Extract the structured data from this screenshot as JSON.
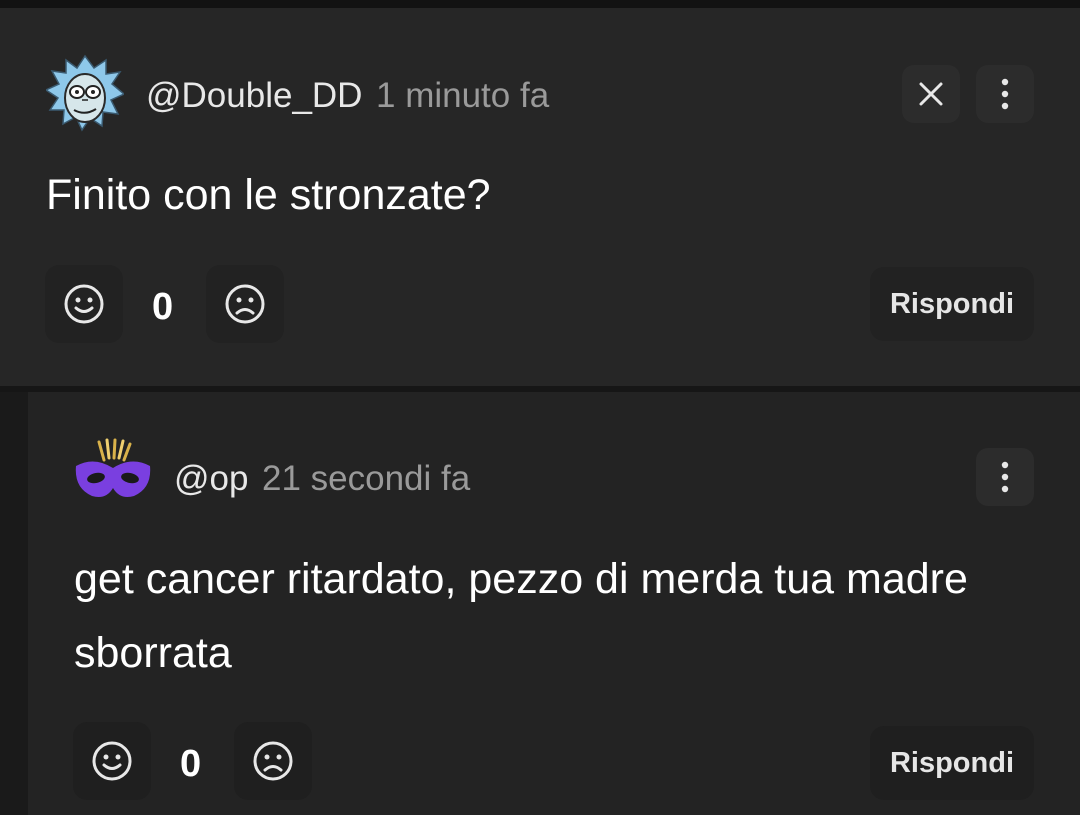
{
  "comments": [
    {
      "username": "@Double_DD",
      "time": "1 minuto fa",
      "text": "Finito con le stronzate?",
      "score": "0",
      "reply_label": "Rispondi",
      "avatar_icon": "cartoon-scientist-avatar",
      "has_close": true
    },
    {
      "username": "@op",
      "time": "21 secondi fa",
      "text": "get cancer ritardato, pezzo di merda tua madre sborrata",
      "score": "0",
      "reply_label": "Rispondi",
      "avatar_icon": "purple-mask-avatar",
      "has_close": false
    }
  ],
  "colors": {
    "background": "#1a1a1a",
    "card": "#262626",
    "reply_card": "#232323",
    "text": "#ffffff",
    "muted": "#9a9a9a",
    "mask_purple": "#7a3fe0"
  },
  "icons": [
    "close-icon",
    "more-vertical-icon",
    "smile-icon",
    "frown-icon"
  ]
}
